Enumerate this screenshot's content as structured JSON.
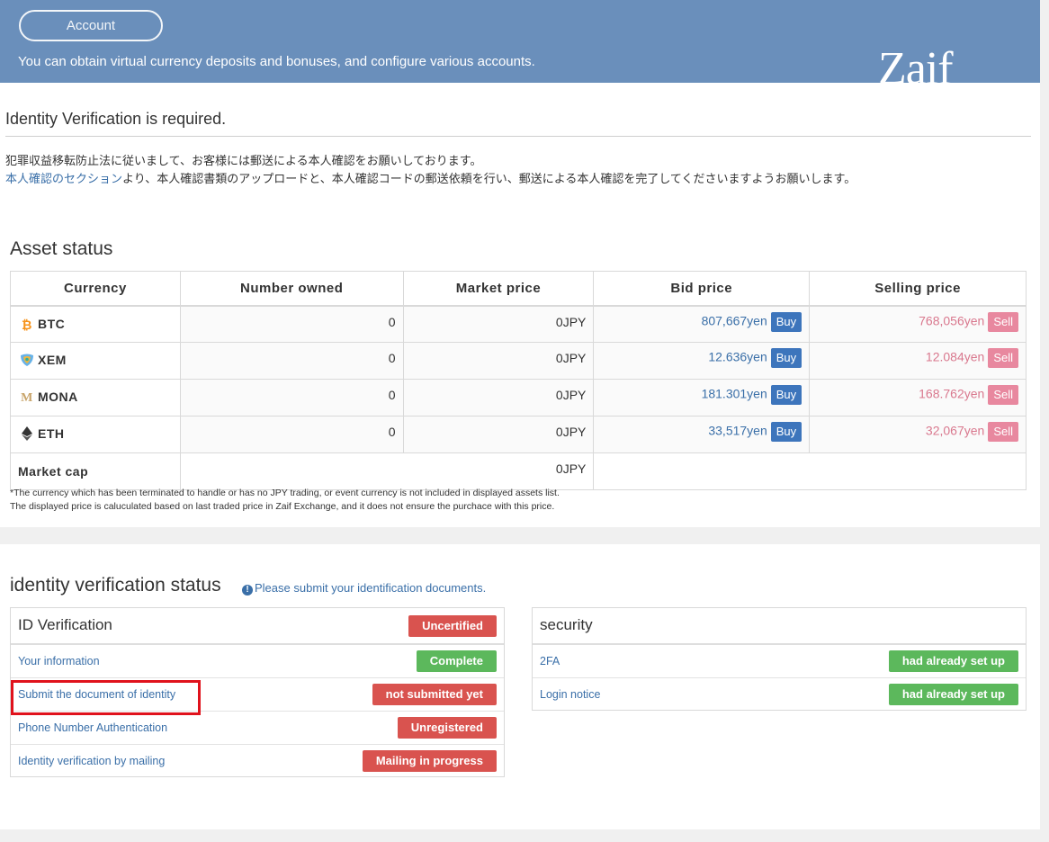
{
  "header": {
    "account_label": "Account",
    "description": "You can obtain virtual currency deposits and bonuses, and configure various accounts.",
    "logo_text": "Zaif"
  },
  "notice": {
    "title": "Identity Verification is required.",
    "line1": "犯罪収益移転防止法に従いまして、お客様には郵送による本人確認をお願いしております。",
    "line2_link": "本人確認のセクション",
    "line2_rest": "より、本人確認書類のアップロードと、本人確認コードの郵送依頼を行い、郵送による本人確認を完了してくださいますようお願いします。"
  },
  "assets": {
    "title": "Asset status",
    "columns": [
      "Currency",
      "Number owned",
      "Market price",
      "Bid price",
      "Selling price"
    ],
    "buy_label": "Buy",
    "sell_label": "Sell",
    "rows": [
      {
        "currency": "BTC",
        "icon": "bitcoin-icon",
        "owned": "0",
        "market": "0JPY",
        "bid": "807,667yen",
        "selling": "768,056yen"
      },
      {
        "currency": "XEM",
        "icon": "nem-icon",
        "owned": "0",
        "market": "0JPY",
        "bid": "12.636yen",
        "selling": "12.084yen"
      },
      {
        "currency": "MONA",
        "icon": "monacoin-icon",
        "owned": "0",
        "market": "0JPY",
        "bid": "181.301yen",
        "selling": "168.762yen"
      },
      {
        "currency": "ETH",
        "icon": "ethereum-icon",
        "owned": "0",
        "market": "0JPY",
        "bid": "33,517yen",
        "selling": "32,067yen"
      }
    ],
    "market_cap_label": "Market cap",
    "market_cap_value": "0JPY",
    "note1": "*The currency which has been terminated to handle or has no JPY trading, or event currency is not included in displayed assets list.",
    "note2": "The displayed price is caluculated based on last traded price in Zaif Exchange, and it does not ensure the purchace with this price."
  },
  "identity": {
    "title": "identity verification status",
    "notice": "Please submit your identification documents.",
    "id_panel": {
      "title": "ID Verification",
      "status": "Uncertified",
      "rows": [
        {
          "label": "Your information",
          "status": "Complete"
        },
        {
          "label": "Submit the document of identity",
          "status": "not submitted yet"
        },
        {
          "label": "Phone Number Authentication",
          "status": "Unregistered"
        },
        {
          "label": "Identity verification by mailing",
          "status": "Mailing in progress"
        }
      ]
    },
    "security_panel": {
      "title": "security",
      "rows": [
        {
          "label": "2FA",
          "status": "had already set up"
        },
        {
          "label": "Login notice",
          "status": "had already set up"
        }
      ]
    }
  },
  "colors": {
    "header_bg": "#6a8fbb",
    "link": "#3a6fa8",
    "buy": "#3d75bc",
    "sell": "#e8889f",
    "badge_red": "#d9534f",
    "badge_green": "#5cb85c",
    "highlight": "#e0121c"
  }
}
